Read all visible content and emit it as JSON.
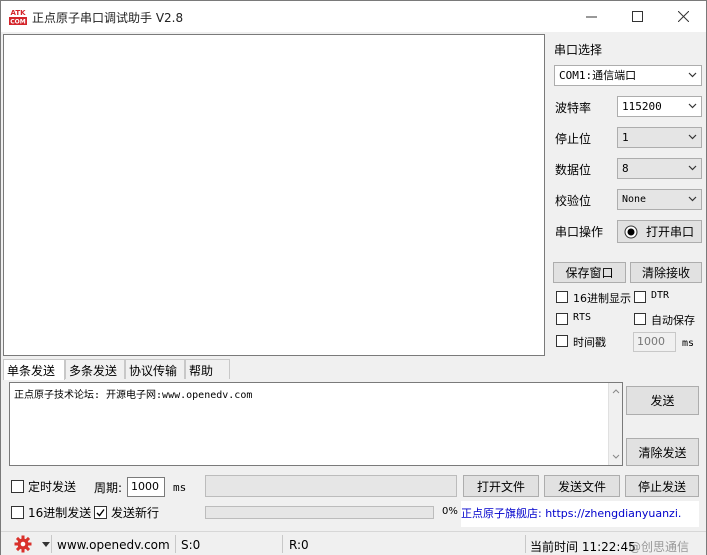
{
  "window": {
    "title": "正点原子串口调试助手 V2.8"
  },
  "settings": {
    "port_select_label": "串口选择",
    "port_value": "COM1:通信端口",
    "baud_label": "波特率",
    "baud_value": "115200",
    "stop_label": "停止位",
    "stop_value": "1",
    "data_label": "数据位",
    "data_value": "8",
    "parity_label": "校验位",
    "parity_value": "None",
    "op_label": "串口操作",
    "open_port_button": "打开串口"
  },
  "recv_controls": {
    "save_window": "保存窗口",
    "clear_recv": "清除接收",
    "hex_display": "16进制显示",
    "dtr": "DTR",
    "rts": "RTS",
    "auto_save": "自动保存",
    "timestamp": "时间戳",
    "interval_value": "1000",
    "interval_unit": "ms"
  },
  "tabs": [
    "单条发送",
    "多条发送",
    "协议传输",
    "帮助"
  ],
  "send": {
    "text": "正点原子技术论坛: 开源电子网:www.openedv.com",
    "send_button": "发送",
    "clear_send_button": "清除发送",
    "timed_send": "定时发送",
    "period_label": "周期:",
    "period_value": "1000",
    "period_unit": "ms",
    "open_file": "打开文件",
    "send_file": "发送文件",
    "stop_send": "停止发送",
    "hex_send": "16进制发送",
    "send_newline": "发送新行",
    "progress_percent": "0%",
    "ad_text": "正点原子旗舰店: https://zhengdianyuanzi."
  },
  "status": {
    "url": "www.openedv.com",
    "sent": "S:0",
    "received": "R:0",
    "time": "当前时间 11:22:45",
    "watermark": "@创思通信"
  },
  "colors": {
    "logo_red": "#d4242a",
    "gear_red": "#d9312b",
    "link_blue": "#0000cc"
  }
}
